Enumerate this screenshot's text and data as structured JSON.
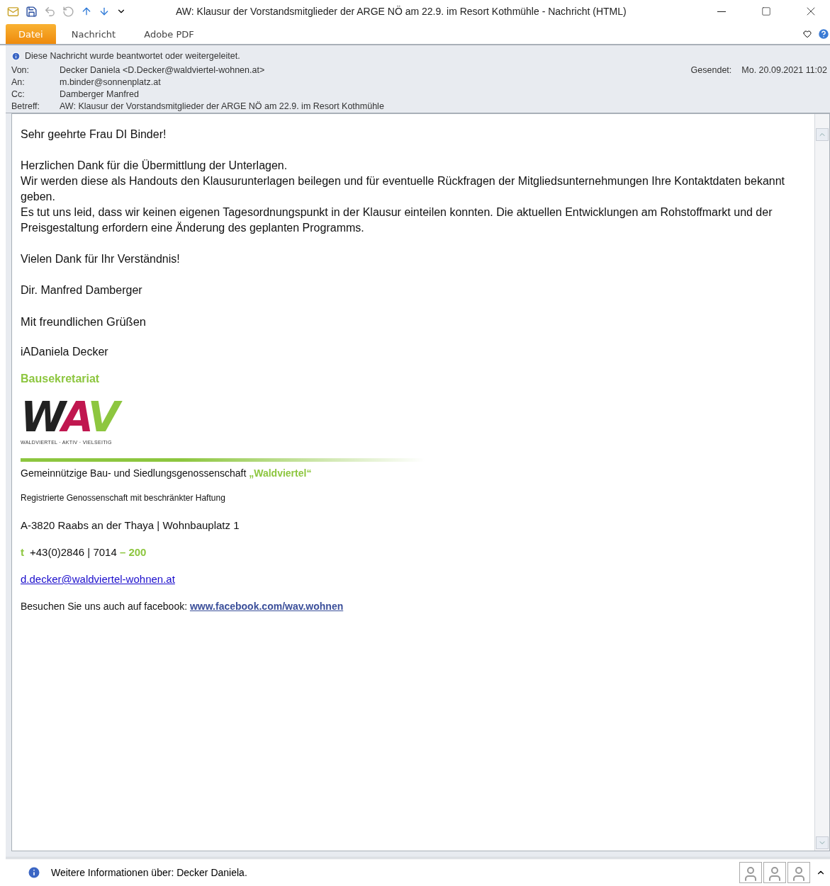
{
  "window": {
    "title": "AW: Klausur der Vorstandsmitglieder der ARGE NÖ am 22.9. im Resort Kothmühle  -  Nachricht (HTML)"
  },
  "ribbon_tabs": [
    {
      "label": "Datei",
      "selected": true
    },
    {
      "label": "Nachricht",
      "selected": false
    },
    {
      "label": "Adobe PDF",
      "selected": false
    }
  ],
  "info_bar": "Diese Nachricht wurde beantwortet oder weitergeleitet.",
  "headers": [
    {
      "label": "Von:",
      "value": "Decker Daniela <D.Decker@waldviertel-wohnen.at>"
    },
    {
      "label": "An:",
      "value": "m.binder@sonnenplatz.at"
    },
    {
      "label": "Cc:",
      "value": "Damberger Manfred"
    },
    {
      "label": "Betreff:",
      "value": "AW: Klausur der Vorstandsmitglieder der ARGE NÖ am 22.9. im Resort Kothmühle"
    }
  ],
  "sent": {
    "label": "Gesendet:",
    "value": "Mo. 20.09.2021 11:02"
  },
  "body": [
    {
      "kind": "text",
      "lines": [
        "Sehr geehrte Frau DI Binder!"
      ]
    },
    {
      "kind": "text",
      "lines": [
        "Herzlichen Dank für die Übermittlung der Unterlagen.",
        "Wir werden diese als Handouts den Klausurunterlagen beilegen und für eventuelle Rückfragen der Mitgliedsunternehmungen Ihre Kontaktdaten bekannt geben.",
        "Es tut uns leid, dass wir keinen eigenen Tagesordnungspunkt in der Klausur einteilen konnten. Die aktuellen Entwicklungen am Rohstoffmarkt und der Preisgestaltung erfordern eine Änderung des geplanten Programms."
      ]
    },
    {
      "kind": "text",
      "lines": [
        "Vielen Dank für Ihr Verständnis!"
      ]
    },
    {
      "kind": "text",
      "lines": [
        "Dir. Manfred Damberger"
      ]
    },
    {
      "kind": "closing",
      "lines": [
        "Mit freundlichen Grüßen"
      ]
    }
  ],
  "signature": {
    "name": "iADaniela Decker",
    "department": "Bausekretariat",
    "logo": {
      "letters": [
        {
          "text": "W",
          "color": "#222222"
        },
        {
          "text": "A",
          "color": "#c0174f"
        },
        {
          "text": "V",
          "color": "#8dc63f"
        }
      ],
      "tagline": "WALDVIERTEL · AKTIV · VIELSEITIG"
    },
    "company": {
      "text": "Gemeinnützige Bau- und Siedlungsgenossenschaft",
      "highlight": "„Waldviertel“"
    },
    "legal": "Registrierte Genossenschaft mit beschränkter Haftung",
    "address": "A-3820 Raabs an der Thaya | Wohnbauplatz 1",
    "phone": {
      "prefix": "t",
      "number": "+43(0)2846 | 7014",
      "extension": "– 200"
    },
    "email": "d.decker@waldviertel-wohnen.at",
    "facebook": {
      "text": "Besuchen Sie uns auch auf facebook:",
      "link": "www.facebook.com/wav.wohnen"
    }
  },
  "status_bar": "Weitere Informationen über: Decker Daniela."
}
